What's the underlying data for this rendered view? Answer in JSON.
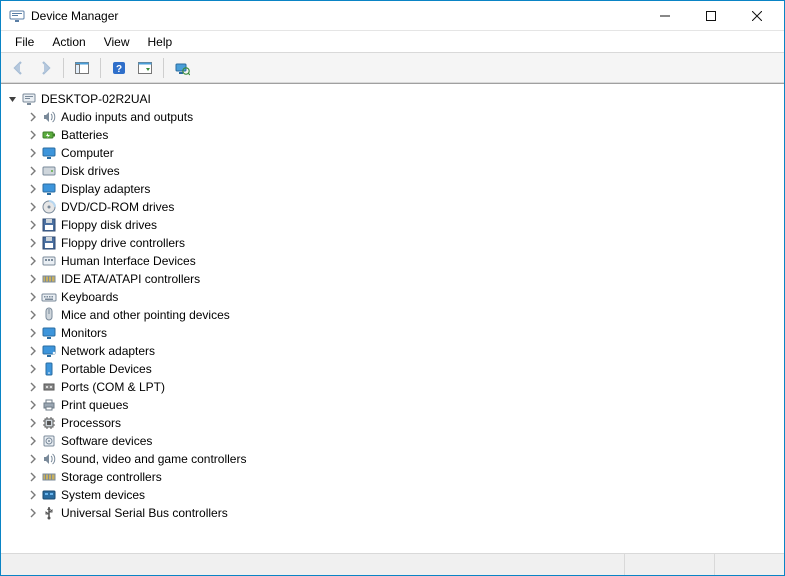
{
  "window": {
    "title": "Device Manager"
  },
  "menu": {
    "file": "File",
    "action": "Action",
    "view": "View",
    "help": "Help"
  },
  "toolbar": {
    "back": "Back",
    "forward": "Forward",
    "show_hide": "Show/Hide Console Tree",
    "help_btn": "Help",
    "action_btn": "Action",
    "scan": "Scan for hardware changes"
  },
  "tree": {
    "root": "DESKTOP-02R2UAI",
    "categories": [
      {
        "label": "Audio inputs and outputs",
        "icon": "speaker"
      },
      {
        "label": "Batteries",
        "icon": "battery"
      },
      {
        "label": "Computer",
        "icon": "monitor"
      },
      {
        "label": "Disk drives",
        "icon": "disk"
      },
      {
        "label": "Display adapters",
        "icon": "monitor"
      },
      {
        "label": "DVD/CD-ROM drives",
        "icon": "optical"
      },
      {
        "label": "Floppy disk drives",
        "icon": "floppy"
      },
      {
        "label": "Floppy drive controllers",
        "icon": "floppy"
      },
      {
        "label": "Human Interface Devices",
        "icon": "hid"
      },
      {
        "label": "IDE ATA/ATAPI controllers",
        "icon": "controller"
      },
      {
        "label": "Keyboards",
        "icon": "keyboard"
      },
      {
        "label": "Mice and other pointing devices",
        "icon": "mouse"
      },
      {
        "label": "Monitors",
        "icon": "monitor"
      },
      {
        "label": "Network adapters",
        "icon": "network"
      },
      {
        "label": "Portable Devices",
        "icon": "portable"
      },
      {
        "label": "Ports (COM & LPT)",
        "icon": "port"
      },
      {
        "label": "Print queues",
        "icon": "printer"
      },
      {
        "label": "Processors",
        "icon": "cpu"
      },
      {
        "label": "Software devices",
        "icon": "software"
      },
      {
        "label": "Sound, video and game controllers",
        "icon": "speaker"
      },
      {
        "label": "Storage controllers",
        "icon": "controller"
      },
      {
        "label": "System devices",
        "icon": "system"
      },
      {
        "label": "Universal Serial Bus controllers",
        "icon": "usb"
      }
    ]
  }
}
